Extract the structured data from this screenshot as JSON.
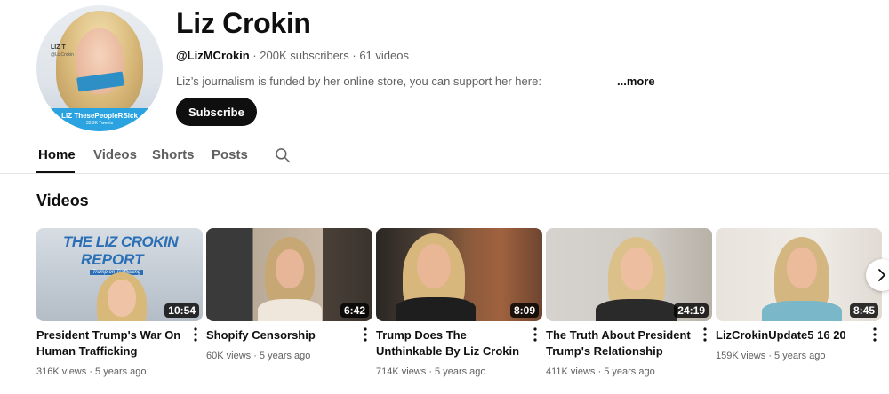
{
  "channel": {
    "name": "Liz Crokin",
    "handle": "@LizMCrokin",
    "subscribers": "200K subscribers",
    "videos_count": "61 videos",
    "separator": " · ",
    "description": "Liz’s journalism is funded by her online store, you can support her here:",
    "more_label": "...more",
    "subscribe_label": "Subscribe",
    "avatar": {
      "banner_text": "LIZ ThesePeopleRSick",
      "banner_sub": "33.9K Tweets",
      "side_text": "LIZ T",
      "side_sub": "@LizCrokin"
    }
  },
  "tabs": [
    {
      "label": "Home",
      "active": true
    },
    {
      "label": "Videos",
      "active": false
    },
    {
      "label": "Shorts",
      "active": false
    },
    {
      "label": "Posts",
      "active": false
    }
  ],
  "section": {
    "title": "Videos"
  },
  "videos": [
    {
      "title": "President Trump's War On Human Trafficking",
      "views": "316K views",
      "age": "5 years ago",
      "duration": "10:54",
      "thumb_text": {
        "line1": "THE LIZ CROKIN",
        "line2": "REPORT",
        "tag": "Trump on Trafficking"
      }
    },
    {
      "title": "Shopify Censorship",
      "views": "60K views",
      "age": "5 years ago",
      "duration": "6:42"
    },
    {
      "title": "Trump Does The Unthinkable By Liz Crokin",
      "views": "714K views",
      "age": "5 years ago",
      "duration": "8:09"
    },
    {
      "title": "The Truth About President Trump's Relationship With…",
      "views": "411K views",
      "age": "5 years ago",
      "duration": "24:19"
    },
    {
      "title": "LizCrokinUpdate5 16 20",
      "views": "159K views",
      "age": "5 years ago",
      "duration": "8:45"
    }
  ],
  "colors": {
    "subscribe_bg": "#0f0f0f",
    "text_secondary": "#606060",
    "banner_blue": "#2aa3e0"
  }
}
